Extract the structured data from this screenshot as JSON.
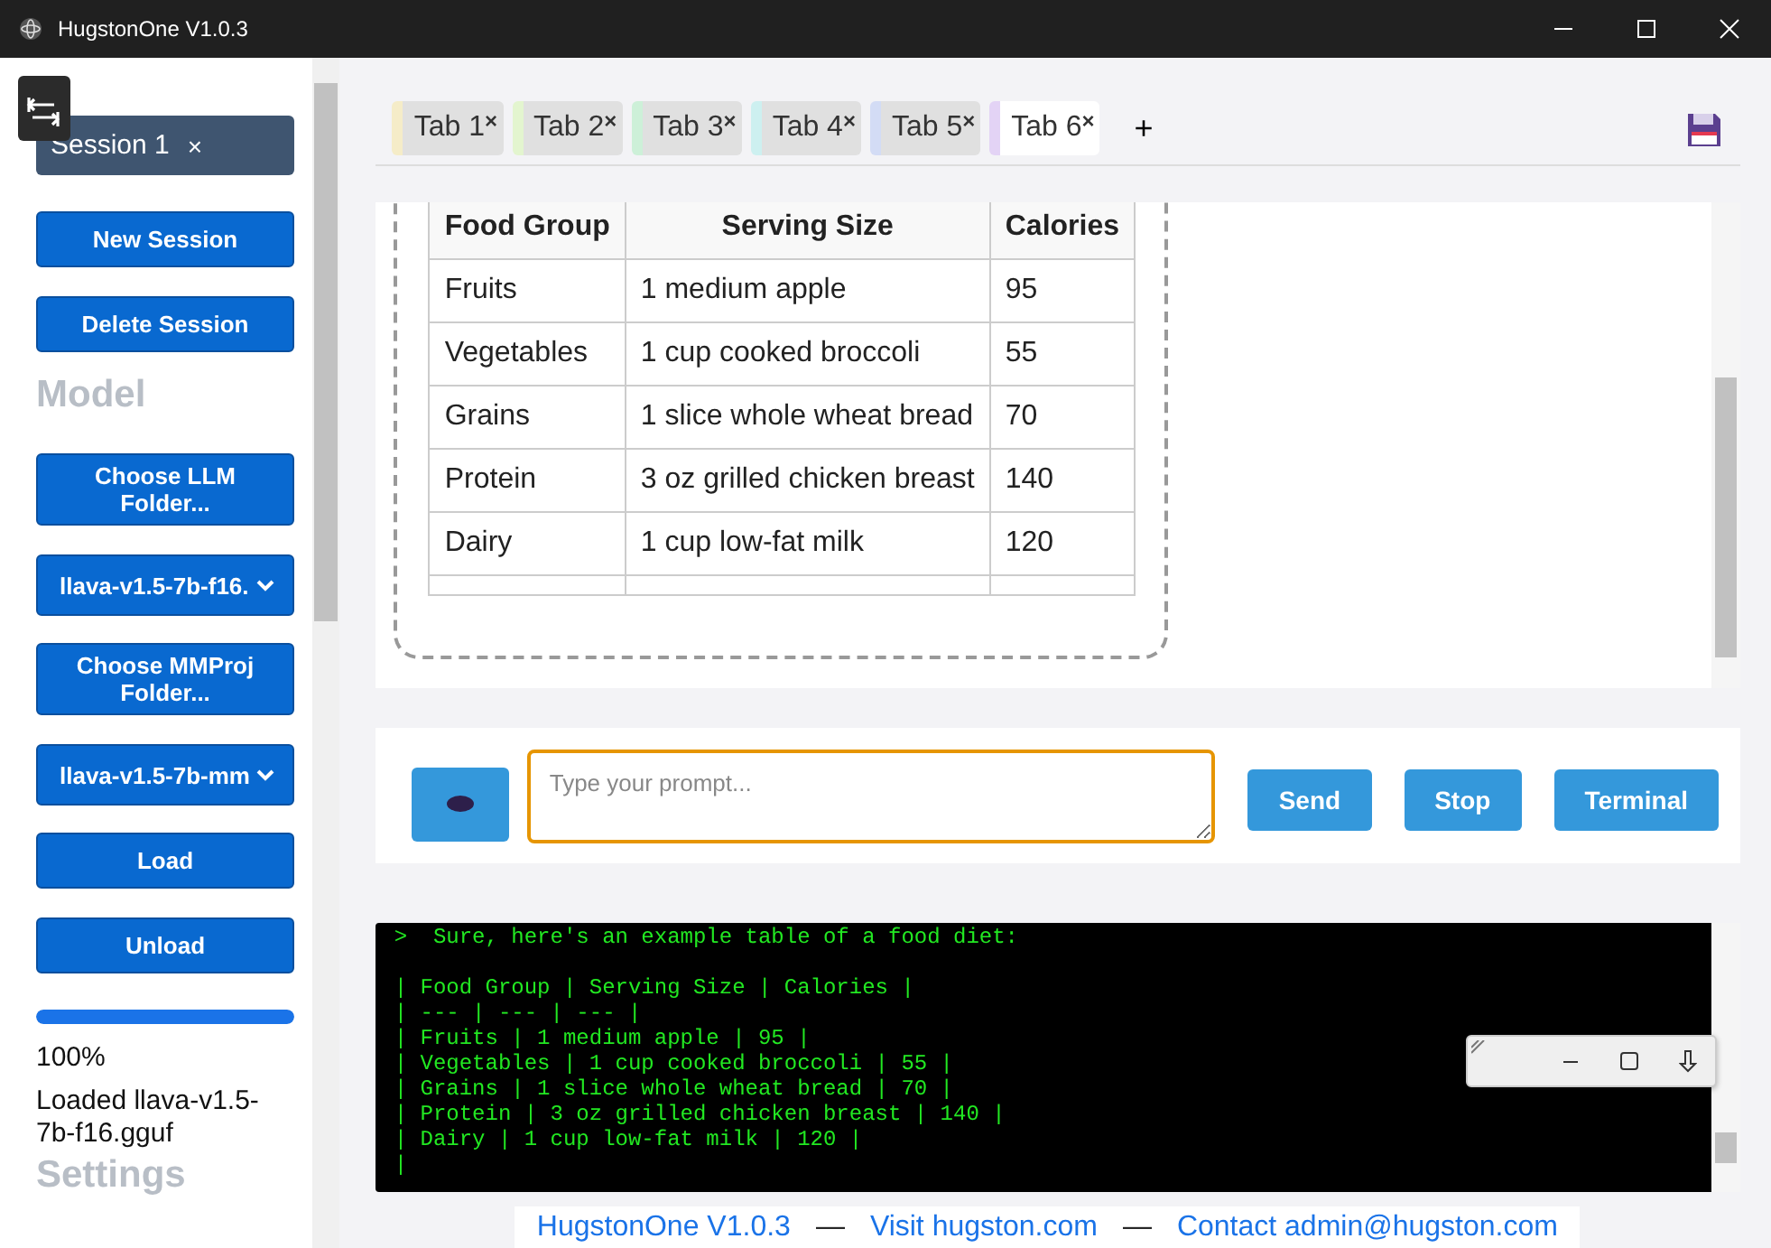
{
  "window": {
    "title": "HugstonOne V1.0.3"
  },
  "sidebar": {
    "session": {
      "label": "Session 1",
      "close": "×"
    },
    "items": [
      {
        "kind": "button",
        "label": "New Session"
      },
      {
        "kind": "button",
        "label": "Delete Session"
      },
      {
        "kind": "heading",
        "label": "Model"
      },
      {
        "kind": "button",
        "label": "Choose LLM Folder..."
      },
      {
        "kind": "select",
        "label": "llava-v1.5-7b-f16."
      },
      {
        "kind": "button",
        "label": "Choose MMProj Folder..."
      },
      {
        "kind": "select",
        "label": "llava-v1.5-7b-mm"
      },
      {
        "kind": "button",
        "label": "Load"
      },
      {
        "kind": "button",
        "label": "Unload"
      },
      {
        "kind": "progress",
        "level": 1
      },
      {
        "kind": "text",
        "label": "100%"
      },
      {
        "kind": "text",
        "label": "Loaded llava-v1.5-7b-f16.gguf"
      },
      {
        "kind": "heading",
        "label": "Settings"
      }
    ]
  },
  "tabs": [
    {
      "label": "Tab 1",
      "close": "×",
      "color": "#f5ecc8",
      "selected": false
    },
    {
      "label": "Tab 2",
      "close": "×",
      "color": "#e3f5cf",
      "selected": false
    },
    {
      "label": "Tab 3",
      "close": "×",
      "color": "#cdf0d8",
      "selected": false
    },
    {
      "label": "Tab 4",
      "close": "×",
      "color": "#cdf0f0",
      "selected": false
    },
    {
      "label": "Tab 5",
      "close": "×",
      "color": "#d3dcf5",
      "selected": false
    },
    {
      "label": "Tab 6",
      "close": "×",
      "color": "#e3d3f5",
      "selected": true
    }
  ],
  "add_tab": "+",
  "table": {
    "columns": [
      "Food Group",
      "Serving Size",
      "Calories"
    ],
    "rows": [
      [
        "Fruits",
        "1 medium apple",
        "95"
      ],
      [
        "Vegetables",
        "1 cup cooked broccoli",
        "55"
      ],
      [
        "Grains",
        "1 slice whole wheat bread",
        "70"
      ],
      [
        "Protein",
        "3 oz grilled chicken breast",
        "140"
      ],
      [
        "Dairy",
        "1 cup low-fat milk",
        "120"
      ]
    ]
  },
  "prompt": {
    "placeholder": "Type your prompt...",
    "buttons": [
      "Send",
      "Stop",
      "Terminal"
    ]
  },
  "terminal": {
    "intro": ">  Sure, here's an example table of a food diet:",
    "lines": [
      "| Food Group | Serving Size | Calories |",
      "| --- | --- | --- |",
      "| Fruits | 1 medium apple | 95 |",
      "| Vegetables | 1 cup cooked broccoli | 55 |",
      "| Grains | 1 slice whole wheat bread | 70 |",
      "| Protein | 3 oz grilled chicken breast | 140 |",
      "| Dairy | 1 cup low-fat milk | 120 |",
      "|"
    ]
  },
  "footer": {
    "version": "HugstonOne V1.0.3",
    "sep": "—",
    "visit": "Visit hugston.com",
    "contact": "Contact admin@hugston.com"
  }
}
